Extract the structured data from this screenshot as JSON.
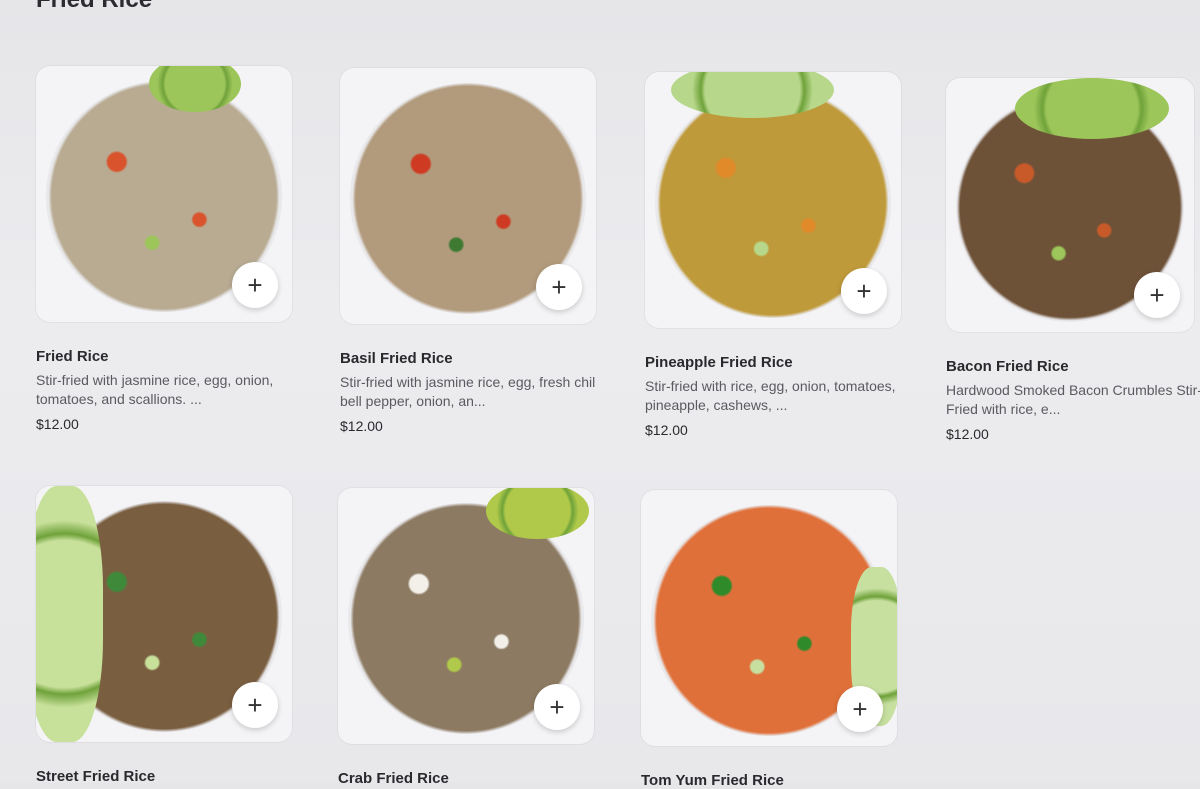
{
  "section": {
    "title": "Fried Rice"
  },
  "add_icon": "+",
  "items": [
    {
      "name": "Fried Rice",
      "description": "Stir-fried with jasmine rice, egg, onion, tomatoes, and scallions. ...",
      "price": "$12.00",
      "colors": {
        "rice": "#b8ab92",
        "accent": "#d9532c",
        "garnish": "#9cc55a"
      }
    },
    {
      "name": "Basil Fried Rice",
      "description": "Stir-fried with jasmine rice, egg, fresh chil bell pepper, onion, an...",
      "price": "$12.00",
      "colors": {
        "rice": "#b29a7c",
        "accent": "#cf3a22",
        "garnish": "#3e7a32"
      }
    },
    {
      "name": "Pineapple Fried Rice",
      "description": "Stir-fried with rice, egg, onion, tomatoes, pineapple, cashews, ...",
      "price": "$12.00",
      "colors": {
        "rice": "#bf9a3a",
        "accent": "#e08a2a",
        "garnish": "#b7d78a"
      }
    },
    {
      "name": "Bacon Fried Rice",
      "description": "Hardwood Smoked Bacon Crumbles Stir-Fried with rice, e...",
      "price": "$12.00",
      "colors": {
        "rice": "#6e5238",
        "accent": "#c85a2a",
        "garnish": "#9cc55a"
      }
    },
    {
      "name": "Street Fried Rice",
      "description": "",
      "price": "",
      "colors": {
        "rice": "#7a5e40",
        "accent": "#3f8a3a",
        "garnish": "#c7e09a"
      }
    },
    {
      "name": "Crab Fried Rice",
      "description": "",
      "price": "",
      "colors": {
        "rice": "#8d7a62",
        "accent": "#f3f0ea",
        "garnish": "#b0c94a"
      }
    },
    {
      "name": "Tom Yum Fried Rice",
      "description": "",
      "price": "",
      "colors": {
        "rice": "#e0703a",
        "accent": "#2f8a2a",
        "garnish": "#c7e0a0"
      }
    }
  ]
}
